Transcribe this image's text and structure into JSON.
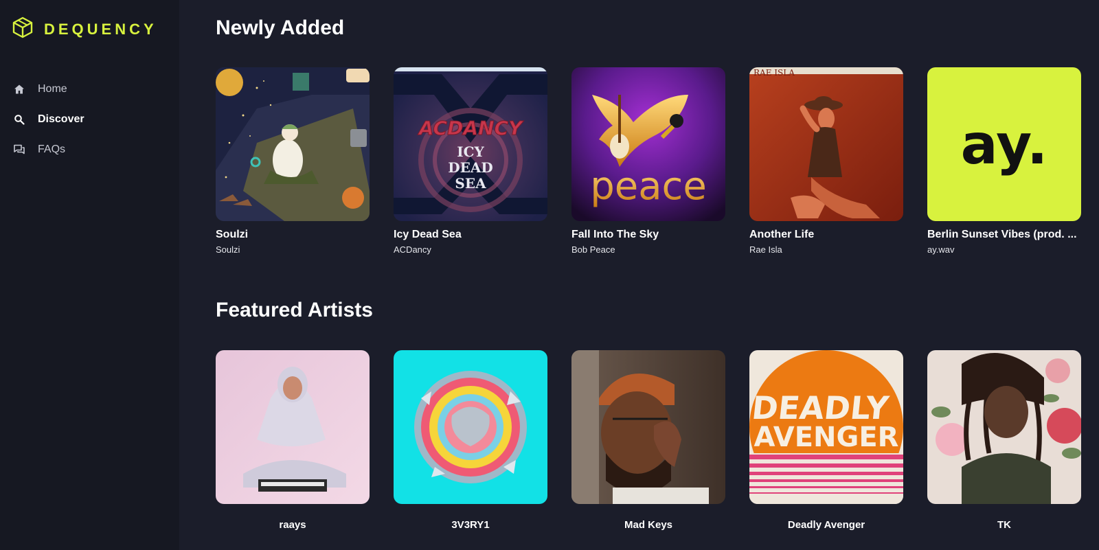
{
  "brand": {
    "name": "DEQUENCY",
    "accent": "#d8f23e",
    "logo_icon": "cube-logo-icon"
  },
  "nav": {
    "items": [
      {
        "label": "Home",
        "icon": "home-icon",
        "active": false
      },
      {
        "label": "Discover",
        "icon": "search-icon",
        "active": true
      },
      {
        "label": "FAQs",
        "icon": "chat-bubbles-icon",
        "active": false
      }
    ]
  },
  "newly_added": {
    "title": "Newly Added",
    "tracks": [
      {
        "title": "Soulzi",
        "artist": "Soulzi"
      },
      {
        "title": "Icy Dead Sea",
        "artist": "ACDancy"
      },
      {
        "title": "Fall Into The Sky",
        "artist": "Bob Peace"
      },
      {
        "title": "Another Life",
        "artist": "Rae Isla"
      },
      {
        "title": "Berlin Sunset Vibes (prod. ...",
        "artist": "ay.wav"
      }
    ]
  },
  "featured_artists": {
    "title": "Featured Artists",
    "artists": [
      {
        "name": "raays"
      },
      {
        "name": "3V3RY1"
      },
      {
        "name": "Mad Keys"
      },
      {
        "name": "Deadly Avenger"
      },
      {
        "name": "TK"
      }
    ]
  },
  "cover_text": {
    "acdancy_logo": "ACDANCY",
    "icy": "ICY",
    "dead": "DEAD",
    "sea": "SEA",
    "peace": "peace",
    "rae_isla": "RAE ISLA",
    "ay": "ay.",
    "deadly": "DEADLY",
    "avenger": "AVENGER"
  }
}
